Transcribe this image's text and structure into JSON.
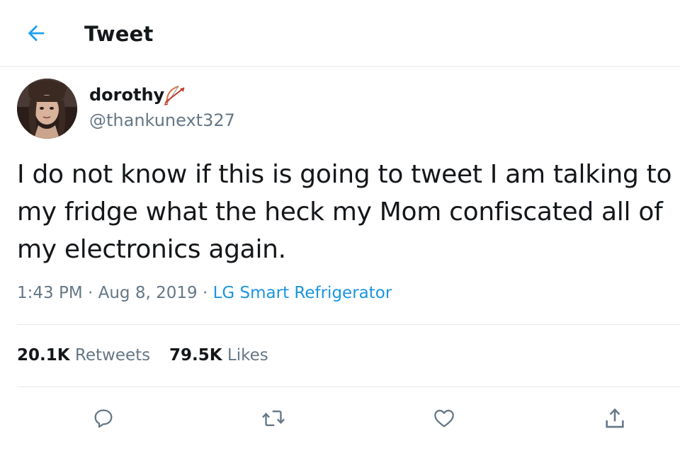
{
  "header": {
    "title": "Tweet",
    "back_icon": "arrow-left-icon"
  },
  "author": {
    "display_name": "dorothy",
    "name_emoji": "bow-and-arrow-emoji",
    "handle": "@thankunext327"
  },
  "tweet": {
    "text": "I do not know if this is going to tweet I am talking to my fridge what the heck my Mom confiscated all of my electronics again.",
    "time": "1:43 PM",
    "separator": "·",
    "date": "Aug 8, 2019",
    "source": "LG Smart Refrigerator"
  },
  "stats": {
    "retweets_count": "20.1K",
    "retweets_label": "Retweets",
    "likes_count": "79.5K",
    "likes_label": "Likes"
  },
  "actions": {
    "reply_icon": "reply-icon",
    "retweet_icon": "retweet-icon",
    "like_icon": "heart-icon",
    "share_icon": "share-icon"
  },
  "colors": {
    "accent": "#1da1f2",
    "link": "#1b95e0",
    "secondary_text": "#657786",
    "primary_text": "#14171a",
    "divider": "#e1e8ed"
  }
}
